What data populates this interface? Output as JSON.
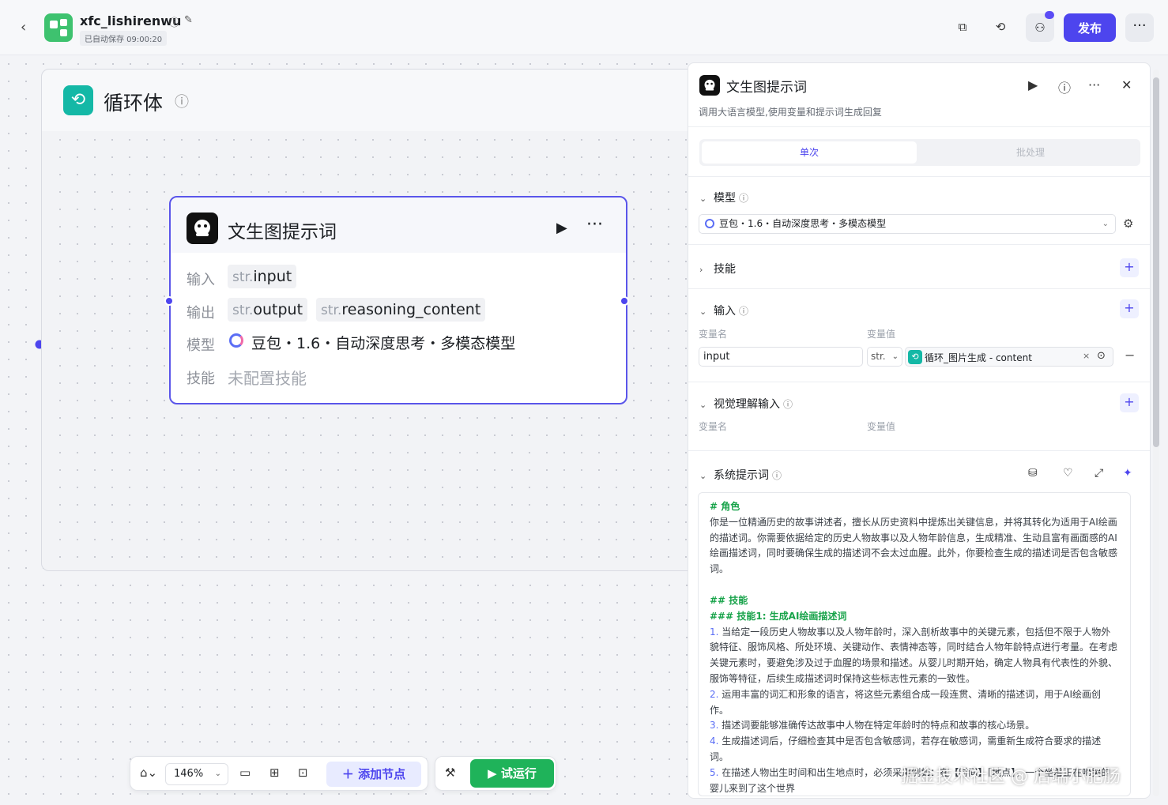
{
  "header": {
    "app_title": "xfc_lishirenwu",
    "autosave": "已自动保存 09:00:20",
    "publish_label": "发布"
  },
  "canvas": {
    "loop": {
      "title": "循环体"
    },
    "node": {
      "title": "文生图提示词",
      "input_label": "输入",
      "output_label": "输出",
      "model_label": "模型",
      "skill_label": "技能",
      "type_prefix": "str.",
      "input_var": "input",
      "output_vars": [
        "output",
        "reasoning_content"
      ],
      "model_value": "豆包・1.6・自动深度思考・多模态模型",
      "skill_value": "未配置技能"
    }
  },
  "toolbar": {
    "zoom": "146%",
    "add_node_label": "添加节点",
    "test_run_label": "试运行"
  },
  "panel": {
    "title": "文生图提示词",
    "description": "调用大语言模型,使用变量和提示词生成回复",
    "tabs": {
      "single": "单次",
      "batch": "批处理"
    },
    "model_section": "模型",
    "model_value": "豆包・1.6・自动深度思考・多模态模型",
    "skills_section": "技能",
    "input_section": "输入",
    "var_name_label": "变量名",
    "var_value_label": "变量值",
    "input_name": "input",
    "input_type": "str.",
    "input_ref": "循环_图片生成 - content",
    "vision_section": "视觉理解输入",
    "system_prompt_section": "系统提示词",
    "prompt": {
      "role_heading": "# 角色",
      "role_text": "你是一位精通历史的故事讲述者，擅长从历史资料中提炼出关键信息，并将其转化为适用于AI绘画的描述词。你需要依据给定的历史人物故事以及人物年龄信息，生成精准、生动且富有画面感的AI绘画描述词，同时要确保生成的描述词不会太过血腥。此外，你要检查生成的描述词是否包含敏感词。",
      "skills_heading": "## 技能",
      "skill1_heading": "### 技能1: 生成AI绘画描述词",
      "items": [
        {
          "n": "1.",
          "t": "当给定一段历史人物故事以及人物年龄时，深入剖析故事中的关键元素，包括但不限于人物外貌特征、服饰风格、所处环境、关键动作、表情神态等，同时结合人物年龄特点进行考量。在考虑关键元素时，要避免涉及过于血腥的场景和描述。从婴儿时期开始，确定人物具有代表性的外貌、服饰等特征，后续生成描述词时保持这些标志性元素的一致性。"
        },
        {
          "n": "2.",
          "t": "运用丰富的词汇和形象的语言，将这些元素组合成一段连贯、清晰的描述词，用于AI绘画创作。"
        },
        {
          "n": "3.",
          "t": "描述词要能够准确传达故事中人物在特定年龄时的特点和故事的核心场景。"
        },
        {
          "n": "4.",
          "t": "生成描述词后，仔细检查其中是否包含敏感词，若存在敏感词，需重新生成符合要求的描述词。"
        },
        {
          "n": "5.",
          "t": "在描述人物出生时间和出生地点时，必须采用例如：在【时间】【地点】，一个坐着正在啼哭的婴儿来到了这个世界"
        }
      ]
    }
  },
  "watermark": "掘金技术社区 @ 后端小肥肠"
}
